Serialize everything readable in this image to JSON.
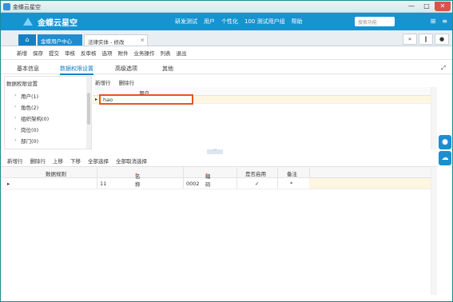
{
  "window": {
    "title": "金蝶云星空",
    "min": "—",
    "max": "□",
    "close": "✕"
  },
  "header": {
    "logo": "金蝶云星空",
    "nav": [
      "研发测试",
      "用户",
      "个性化",
      "100 测试用户组",
      "帮助"
    ],
    "search_placeholder": "搜索功能"
  },
  "tabs": {
    "home": "⌂",
    "tab1": "金蝶用户中心",
    "tab2": "法律实体 - 修改"
  },
  "toolbar": [
    "新增",
    "保存",
    "提交",
    "审核",
    "反审核",
    "选项",
    "附件",
    "业务操作",
    "列表",
    "退出"
  ],
  "subtabs": [
    "基本信息",
    "数据权限设置",
    "高级选项",
    "其他"
  ],
  "tree": {
    "heading": "数据权限设置",
    "items": [
      "用户(1)",
      "角色(2)",
      "组织架构(0)",
      "岗位(0)",
      "部门(0)"
    ]
  },
  "right_pane": {
    "tools": [
      "新增行",
      "删除行"
    ],
    "col_header": "用户",
    "input_value": "hao"
  },
  "bottom": {
    "tools": [
      "新增行",
      "删除行",
      "上移",
      "下移",
      "全部选择",
      "全部取消选择"
    ],
    "headers": [
      "数据规则",
      "名称",
      "编码",
      "是否启用",
      "备注"
    ],
    "row": {
      "name": "11",
      "code": "0002",
      "check": "✓",
      "star": "*"
    }
  }
}
